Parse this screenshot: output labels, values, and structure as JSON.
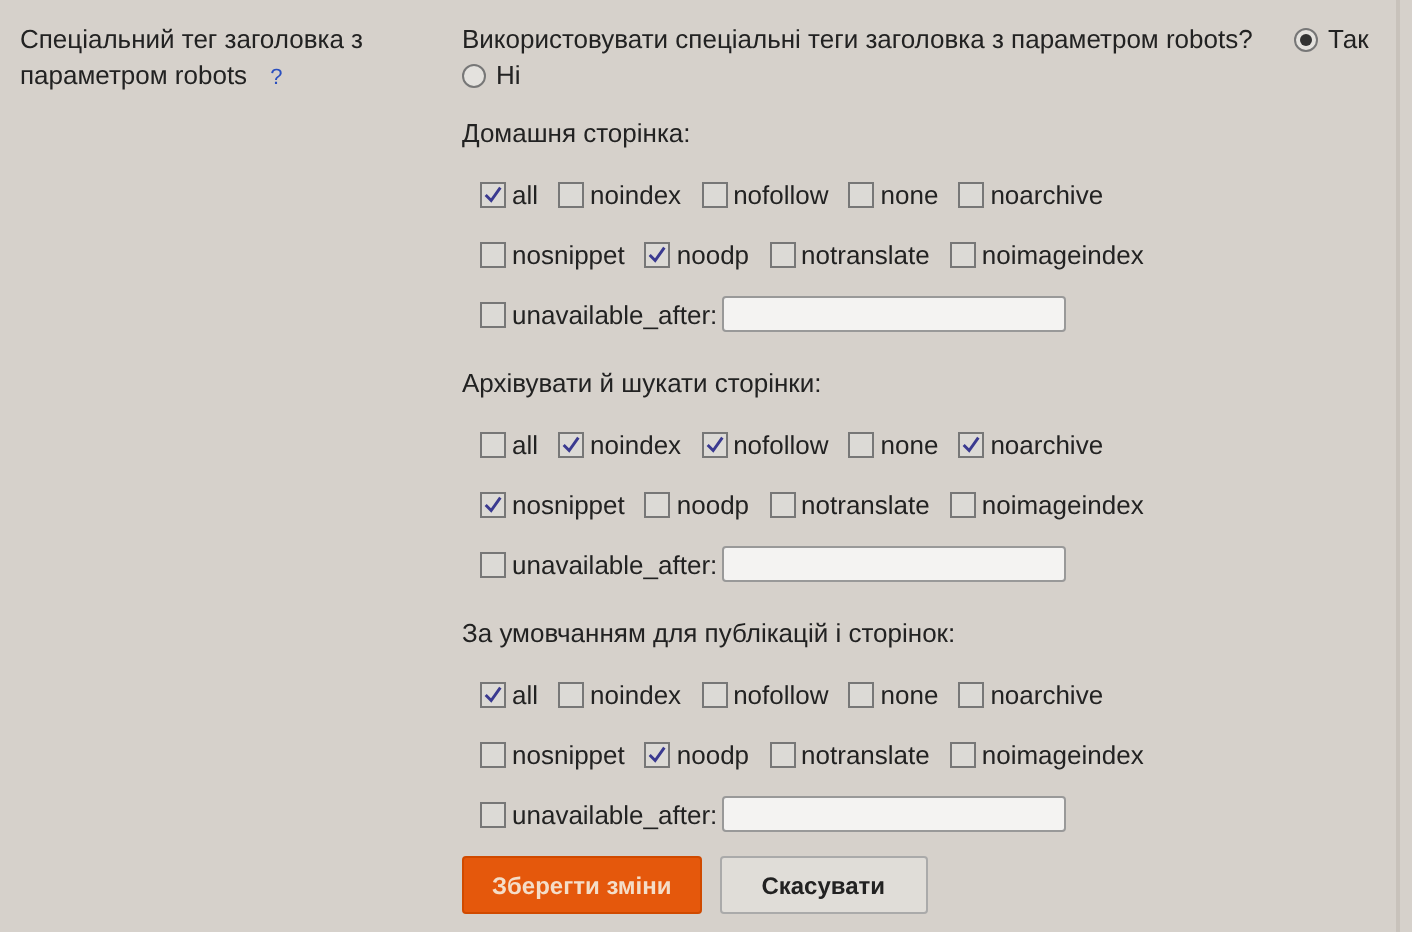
{
  "setting": {
    "label": "Спеціальний тег заголовка з параметром robots",
    "help": "?"
  },
  "question": {
    "text": "Використовувати спеціальні теги заголовка з параметром robots?",
    "options": [
      {
        "label": "Так",
        "selected": true
      },
      {
        "label": "Ні",
        "selected": false
      }
    ]
  },
  "sections": [
    {
      "title": "Домашня сторінка:",
      "options": [
        {
          "label": "all",
          "checked": true
        },
        {
          "label": "noindex",
          "checked": false
        },
        {
          "label": "nofollow",
          "checked": false
        },
        {
          "label": "none",
          "checked": false
        },
        {
          "label": "noarchive",
          "checked": false
        },
        {
          "label": "nosnippet",
          "checked": false
        },
        {
          "label": "noodp",
          "checked": true
        },
        {
          "label": "notranslate",
          "checked": false
        },
        {
          "label": "noimageindex",
          "checked": false
        }
      ],
      "unavailable": {
        "label": "unavailable_after:",
        "checked": false
      }
    },
    {
      "title": "Архівувати й шукати сторінки:",
      "options": [
        {
          "label": "all",
          "checked": false
        },
        {
          "label": "noindex",
          "checked": true
        },
        {
          "label": "nofollow",
          "checked": true
        },
        {
          "label": "none",
          "checked": false
        },
        {
          "label": "noarchive",
          "checked": true
        },
        {
          "label": "nosnippet",
          "checked": true
        },
        {
          "label": "noodp",
          "checked": false
        },
        {
          "label": "notranslate",
          "checked": false
        },
        {
          "label": "noimageindex",
          "checked": false
        }
      ],
      "unavailable": {
        "label": "unavailable_after:",
        "checked": false
      }
    },
    {
      "title": "За умовчанням для публікацій і сторінок:",
      "options": [
        {
          "label": "all",
          "checked": true
        },
        {
          "label": "noindex",
          "checked": false
        },
        {
          "label": "nofollow",
          "checked": false
        },
        {
          "label": "none",
          "checked": false
        },
        {
          "label": "noarchive",
          "checked": false
        },
        {
          "label": "nosnippet",
          "checked": false
        },
        {
          "label": "noodp",
          "checked": true
        },
        {
          "label": "notranslate",
          "checked": false
        },
        {
          "label": "noimageindex",
          "checked": false
        }
      ],
      "unavailable": {
        "label": "unavailable_after:",
        "checked": false
      }
    }
  ],
  "buttons": [
    {
      "label": "Зберегти зміни",
      "kind": "primary"
    },
    {
      "label": "Скасувати",
      "kind": "secondary"
    }
  ]
}
